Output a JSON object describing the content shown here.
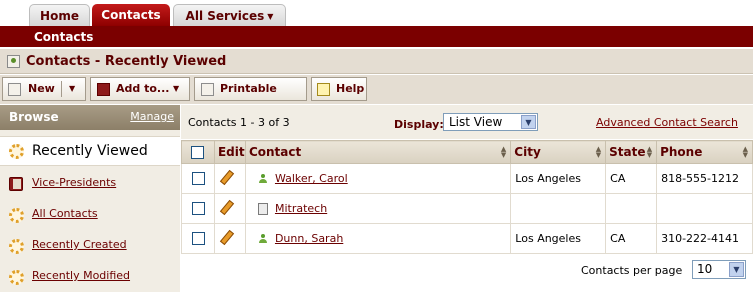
{
  "tabs": [
    {
      "label": "Home"
    },
    {
      "label": "Contacts"
    },
    {
      "label": "All Services"
    }
  ],
  "subnav": {
    "title": "Contacts"
  },
  "page": {
    "title": "Contacts - Recently Viewed"
  },
  "toolbar": {
    "new_label": "New",
    "add_to_label": "Add to...",
    "printable_label": "Printable View",
    "help_label": "Help"
  },
  "sidebar": {
    "browse_label": "Browse",
    "manage_label": "Manage",
    "active_item": "Recently Viewed",
    "items": [
      {
        "label": "Vice-Presidents"
      },
      {
        "label": "All Contacts"
      },
      {
        "label": "Recently Created"
      },
      {
        "label": "Recently Modified"
      }
    ]
  },
  "list": {
    "count_text": "Contacts 1 - 3 of 3",
    "display_label": "Display:",
    "display_value": "List View",
    "advanced_search": "Advanced Contact Search",
    "columns": [
      "Edit",
      "Contact",
      "City",
      "State",
      "Phone"
    ],
    "rows": [
      {
        "contact": "Walker, Carol",
        "type": "person",
        "city": "Los Angeles",
        "state": "CA",
        "phone": "818-555-1212"
      },
      {
        "contact": "Mitratech",
        "type": "company",
        "city": "",
        "state": "",
        "phone": ""
      },
      {
        "contact": "Dunn, Sarah",
        "type": "person",
        "city": "Los Angeles",
        "state": "CA",
        "phone": "310-222-4141"
      }
    ],
    "per_page_label": "Contacts per page",
    "per_page_value": "10"
  },
  "colors": {
    "brand_dark_red": "#7b0000",
    "active_tab_red": "#c31b1b",
    "panel_beige": "#e4ddd2",
    "link_red": "#6b0000"
  }
}
